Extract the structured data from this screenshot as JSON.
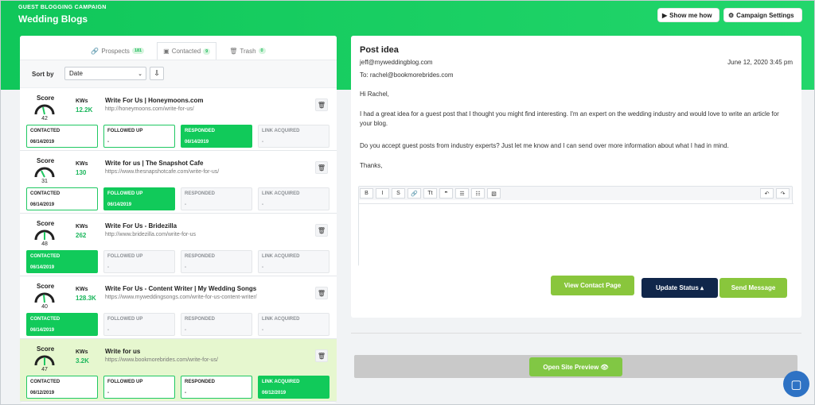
{
  "header": {
    "campaign_label": "GUEST BLOGGING CAMPAIGN",
    "campaign_title": "Wedding Blogs",
    "show_me_how": "Show me how",
    "campaign_settings": "Campaign Settings"
  },
  "tabs": [
    {
      "label": "Prospects",
      "count": "181"
    },
    {
      "label": "Contacted",
      "count": "9"
    },
    {
      "label": "Trash",
      "count": "0"
    }
  ],
  "sort": {
    "label": "Sort by",
    "selected": "Date"
  },
  "prospects": [
    {
      "score_label": "Score",
      "score": "42",
      "kws_label": "KWs",
      "kws": "12.2K",
      "title": "Write For Us | Honeymoons.com",
      "url": "http://honeymoons.com/write-for-us/",
      "statuses": [
        {
          "label": "CONTACTED",
          "date": "06/14/2019",
          "state": "white"
        },
        {
          "label": "FOLLOWED UP",
          "date": "-",
          "state": "white"
        },
        {
          "label": "RESPONDED",
          "date": "06/14/2019",
          "state": "green"
        },
        {
          "label": "LINK ACQUIRED",
          "date": "-",
          "state": "gray"
        }
      ]
    },
    {
      "score_label": "Score",
      "score": "31",
      "kws_label": "KWs",
      "kws": "130",
      "title": "Write for us | The Snapshot Cafe",
      "url": "https://www.thesnapshotcafe.com/write-for-us/",
      "statuses": [
        {
          "label": "CONTACTED",
          "date": "06/14/2019",
          "state": "white"
        },
        {
          "label": "FOLLOWED UP",
          "date": "06/14/2019",
          "state": "green"
        },
        {
          "label": "RESPONDED",
          "date": "-",
          "state": "gray"
        },
        {
          "label": "LINK ACQUIRED",
          "date": "-",
          "state": "gray"
        }
      ]
    },
    {
      "score_label": "Score",
      "score": "48",
      "kws_label": "KWs",
      "kws": "262",
      "title": "Write For Us - Bridezilla",
      "url": "http://www.bridezilla.com/write-for-us",
      "statuses": [
        {
          "label": "CONTACTED",
          "date": "06/14/2019",
          "state": "green"
        },
        {
          "label": "FOLLOWED UP",
          "date": "-",
          "state": "gray"
        },
        {
          "label": "RESPONDED",
          "date": "-",
          "state": "gray"
        },
        {
          "label": "LINK ACQUIRED",
          "date": "-",
          "state": "gray"
        }
      ]
    },
    {
      "score_label": "Score",
      "score": "40",
      "kws_label": "KWs",
      "kws": "128.3K",
      "title": "Write For Us - Content Writer | My Wedding Songs",
      "url": "https://www.myweddingsongs.com/write-for-us-content-writer/",
      "statuses": [
        {
          "label": "CONTACTED",
          "date": "06/14/2019",
          "state": "green"
        },
        {
          "label": "FOLLOWED UP",
          "date": "-",
          "state": "gray"
        },
        {
          "label": "RESPONDED",
          "date": "-",
          "state": "gray"
        },
        {
          "label": "LINK ACQUIRED",
          "date": "-",
          "state": "gray"
        }
      ]
    },
    {
      "score_label": "Score",
      "score": "47",
      "kws_label": "KWs",
      "kws": "3.2K",
      "title": "Write for us",
      "url": "https://www.bookmorebrides.com/write-for-us/",
      "statuses": [
        {
          "label": "CONTACTED",
          "date": "06/12/2019",
          "state": "white"
        },
        {
          "label": "FOLLOWED UP",
          "date": "-",
          "state": "white"
        },
        {
          "label": "RESPONDED",
          "date": "-",
          "state": "white"
        },
        {
          "label": "LINK ACQUIRED",
          "date": "06/12/2019",
          "state": "green"
        }
      ]
    }
  ],
  "post": {
    "title": "Post idea",
    "from": "jeff@myweddingblog.com",
    "to": "To: rachel@bookmorebrides.com",
    "date": "June 12, 2020 3:45 pm",
    "greeting": "Hi Rachel,",
    "paragraph1": "I had a great idea for a guest post that I thought you might find interesting. I'm an expert on the wedding industry and would love to write an article for your blog.",
    "paragraph2": "Do you accept guest posts from industry experts? Just let me know and I can send over more information about what I had in mind.",
    "closing": "Thanks,"
  },
  "editor": {
    "tools": [
      "B",
      "I",
      "S",
      "🔗",
      "Tt",
      "❞",
      "☰",
      "☷",
      "▧"
    ],
    "undo": "↶",
    "redo": "↷"
  },
  "actions": {
    "view_contact": "View Contact Page",
    "update_status": "Update Status ▴",
    "send_message": "Send Message",
    "open_preview": "Open Site Preview 👁"
  },
  "colors": {
    "green": "#11ca5a",
    "navy": "#10264a",
    "lime": "#89c63c",
    "blue": "#2e72c4"
  }
}
